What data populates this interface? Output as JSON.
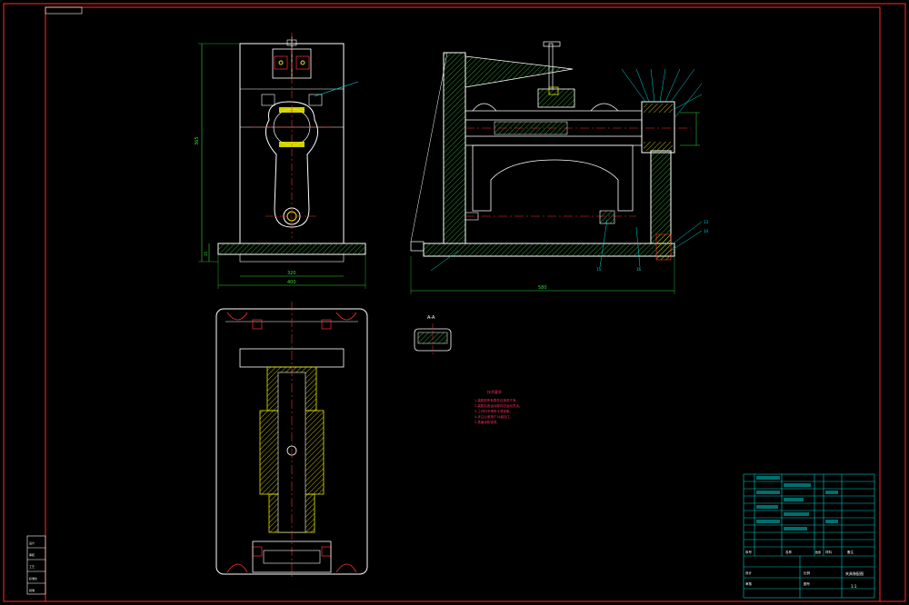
{
  "colors": {
    "background": "#000000",
    "border": "#ff2a2a",
    "outline": "#ffffff",
    "hatch": "#3cc83c",
    "dimension": "#38d838",
    "center": "#ff3030",
    "part": "#e8e800",
    "leader": "#00d8d8",
    "title_block": "#00c8c8",
    "notes": "#ff3060"
  },
  "front_view": {
    "overall_height_dim": "365",
    "base_height_dim": "35",
    "inner_width_dim": "320",
    "outer_width_dim": "400"
  },
  "side_view": {
    "overall_width_dim": "580",
    "callouts": [
      "13",
      "14",
      "15",
      "16"
    ]
  },
  "section": {
    "label": "A-A"
  },
  "notes": {
    "title": "技术要求",
    "lines": [
      "1.装配前所有零件应清洗干净。",
      "2.装配后各运动部件应运动灵活。",
      "3.工作时不得有卡滞现象。",
      "4.未注公差按IT14级加工。",
      "5.表面涂防锈漆。"
    ]
  },
  "title_block": {
    "header_labels": [
      "序号",
      "名称",
      "数量",
      "材料",
      "备注"
    ],
    "footer_labels": [
      "设计",
      "审核",
      "比例",
      "图号"
    ],
    "drawing_name": "夹具装配图",
    "sheet": "1:1"
  },
  "left_table": {
    "rows": [
      "设计",
      "审核",
      "工艺",
      "标准化",
      "批准"
    ]
  }
}
